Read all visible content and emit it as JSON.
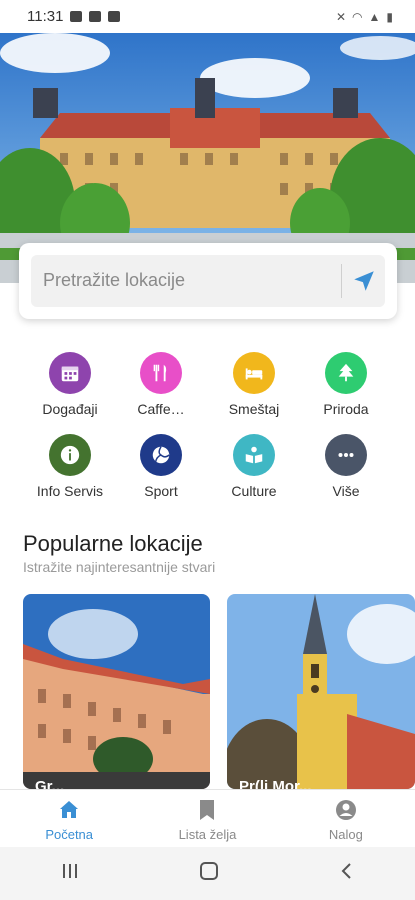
{
  "status": {
    "time": "11:31"
  },
  "search": {
    "placeholder": "Pretražite lokacije"
  },
  "categories": [
    {
      "label": "Događaji",
      "color": "#8e44ad",
      "icon": "calendar-icon"
    },
    {
      "label": "Caffe…",
      "color": "#e84fc8",
      "icon": "fork-knife-icon"
    },
    {
      "label": "Smeštaj",
      "color": "#f1b71c",
      "icon": "bed-icon"
    },
    {
      "label": "Priroda",
      "color": "#2ecc71",
      "icon": "tree-icon"
    },
    {
      "label": "Info Servis",
      "color": "#44732f",
      "icon": "info-icon"
    },
    {
      "label": "Sport",
      "color": "#1f3a8a",
      "icon": "volleyball-icon"
    },
    {
      "label": "Culture",
      "color": "#3fb7c4",
      "icon": "book-reader-icon"
    },
    {
      "label": "Više",
      "color": "#4a5568",
      "icon": "more-dots-icon"
    }
  ],
  "popular": {
    "title": "Popularne lokacije",
    "subtitle": "Istražite najinteresantnije stvari",
    "cards": [
      {
        "label": "Gr..."
      },
      {
        "label": "Pr(li Mor..."
      }
    ]
  },
  "bottom_nav": [
    {
      "label": "Početna",
      "icon": "home-icon"
    },
    {
      "label": "Lista želja",
      "icon": "bookmark-icon"
    },
    {
      "label": "Nalog",
      "icon": "account-icon"
    }
  ]
}
